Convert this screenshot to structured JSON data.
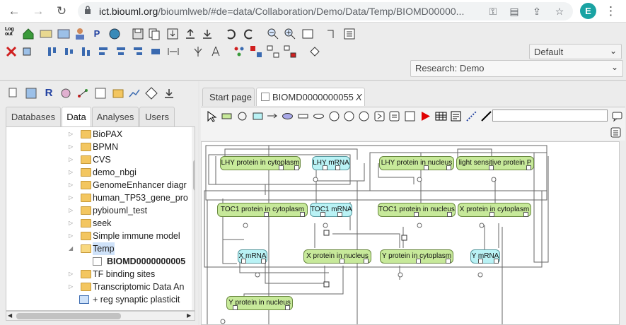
{
  "browser": {
    "url_host": "ict.biouml.org",
    "url_path": "/bioumlweb/#de=data/Collaboration/Demo/Data/Temp/BIOMD00000...",
    "avatar_letter": "E"
  },
  "toolbar": {
    "logout_label": "Log out",
    "perspective_value": "Default",
    "project_value": "Research: Demo"
  },
  "left_tabs": [
    "Databases",
    "Data",
    "Analyses",
    "Users"
  ],
  "tree": [
    {
      "label": "BioPAX",
      "type": "folder"
    },
    {
      "label": "BPMN",
      "type": "folder"
    },
    {
      "label": "CVS",
      "type": "folder"
    },
    {
      "label": "demo_nbgi",
      "type": "folder"
    },
    {
      "label": "GenomeEnhancer diagr",
      "type": "folder"
    },
    {
      "label": "human_TP53_gene_pro",
      "type": "folder"
    },
    {
      "label": "pybiouml_test",
      "type": "folder"
    },
    {
      "label": "seek",
      "type": "folder"
    },
    {
      "label": "Simple immune model",
      "type": "folder"
    },
    {
      "label": "Temp",
      "type": "folder-open"
    },
    {
      "label": "BIOMD0000000005",
      "type": "diagram"
    },
    {
      "label": "TF binding sites",
      "type": "folder"
    },
    {
      "label": "Transcriptomic Data An",
      "type": "folder"
    },
    {
      "label": "+ reg synaptic plasticit",
      "type": "item"
    }
  ],
  "doc_tabs": {
    "start": "Start page",
    "active": "BIOMD0000000055",
    "close": "X"
  },
  "nodes": [
    {
      "label": "LHY protein in cytoplasm",
      "kind": "cp"
    },
    {
      "label": "LHY mRNA",
      "kind": "rna"
    },
    {
      "label": "LHY protein in nucleus",
      "kind": "cp"
    },
    {
      "label": "light sensitive protein P",
      "kind": "cp"
    },
    {
      "label": "TOC1 protein in cytoplasm",
      "kind": "cp"
    },
    {
      "label": "TOC1 mRNA",
      "kind": "rna"
    },
    {
      "label": "TOC1 protein in nucleus",
      "kind": "cp"
    },
    {
      "label": "X protein in cytoplasm",
      "kind": "cp"
    },
    {
      "label": "X mRNA",
      "kind": "rna"
    },
    {
      "label": "X protein in nucleus",
      "kind": "cp"
    },
    {
      "label": "Y protein in cytoplasm",
      "kind": "cp"
    },
    {
      "label": "Y mRNA",
      "kind": "rna"
    },
    {
      "label": "Y protein in nucleus",
      "kind": "cp"
    }
  ],
  "colors": {
    "complex": "#c7e99a",
    "mrna": "#b9f2f5",
    "selection": "#cfe2f9",
    "play_icon": "#e00000"
  }
}
